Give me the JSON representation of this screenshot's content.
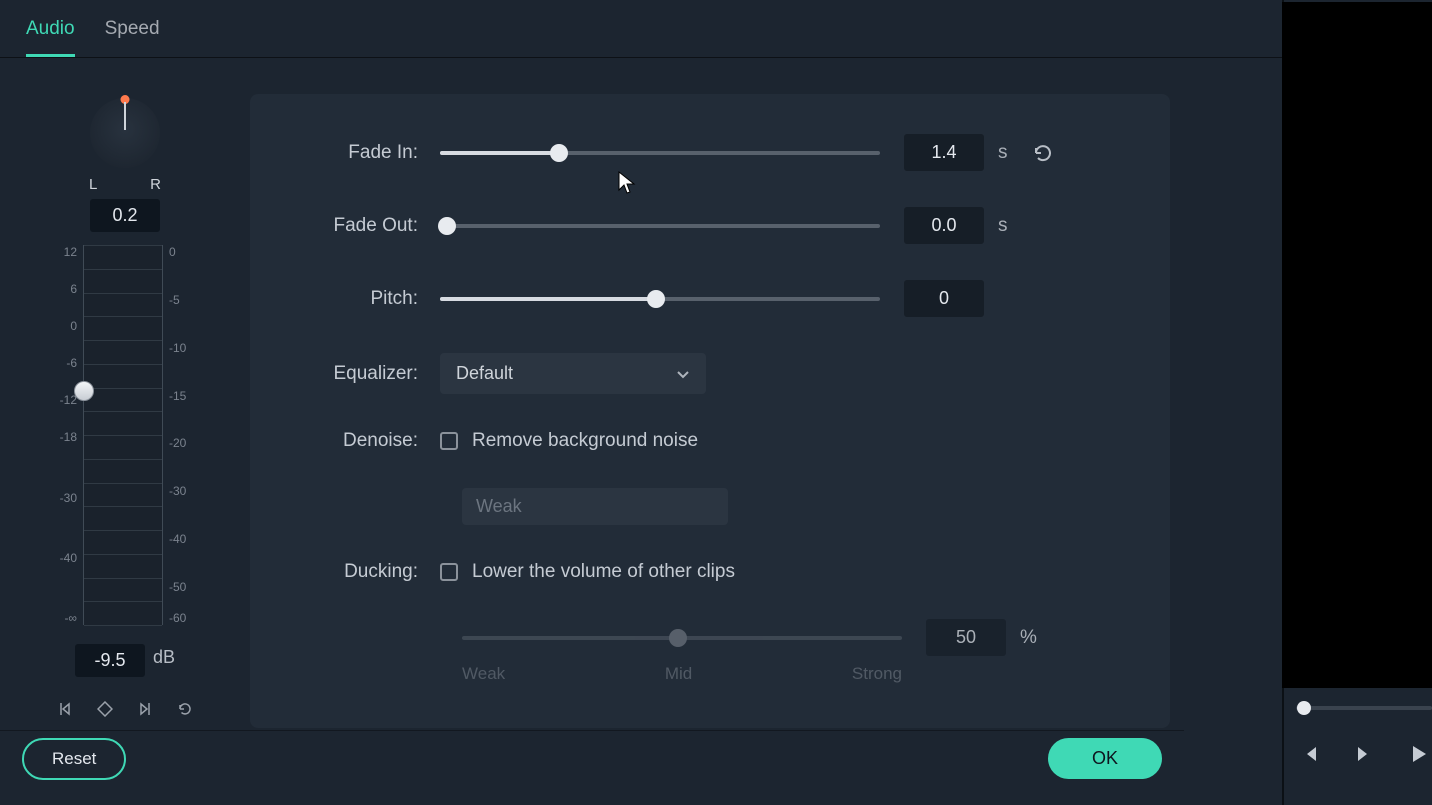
{
  "tabs": {
    "audio": "Audio",
    "speed": "Speed"
  },
  "pan": {
    "l": "L",
    "r": "R",
    "value": "0.2"
  },
  "meter": {
    "left_ticks": [
      "12",
      "6",
      "0",
      "-6",
      "-12",
      "-18",
      "",
      "-30",
      "",
      "-40",
      "",
      "-∞"
    ],
    "right_ticks": [
      "0",
      "",
      "-5",
      "",
      "-10",
      "",
      "-15",
      "",
      "-20",
      "",
      "-30",
      "",
      "-40",
      "",
      "-50",
      "-60"
    ],
    "db_value": "-9.5",
    "db_unit": "dB"
  },
  "settings": {
    "fade_in": {
      "label": "Fade In:",
      "value": "1.4",
      "unit": "s",
      "pct": 27
    },
    "fade_out": {
      "label": "Fade Out:",
      "value": "0.0",
      "unit": "s",
      "pct": 1.5
    },
    "pitch": {
      "label": "Pitch:",
      "value": "0",
      "pct": 49
    },
    "equalizer": {
      "label": "Equalizer:",
      "selected": "Default"
    },
    "denoise": {
      "label": "Denoise:",
      "check_label": "Remove background noise",
      "strength": "Weak"
    },
    "ducking": {
      "label": "Ducking:",
      "check_label": "Lower the volume of other clips",
      "value": "50",
      "unit": "%",
      "scale": {
        "weak": "Weak",
        "mid": "Mid",
        "strong": "Strong"
      },
      "pct": 49
    }
  },
  "footer": {
    "reset": "Reset",
    "ok": "OK"
  }
}
